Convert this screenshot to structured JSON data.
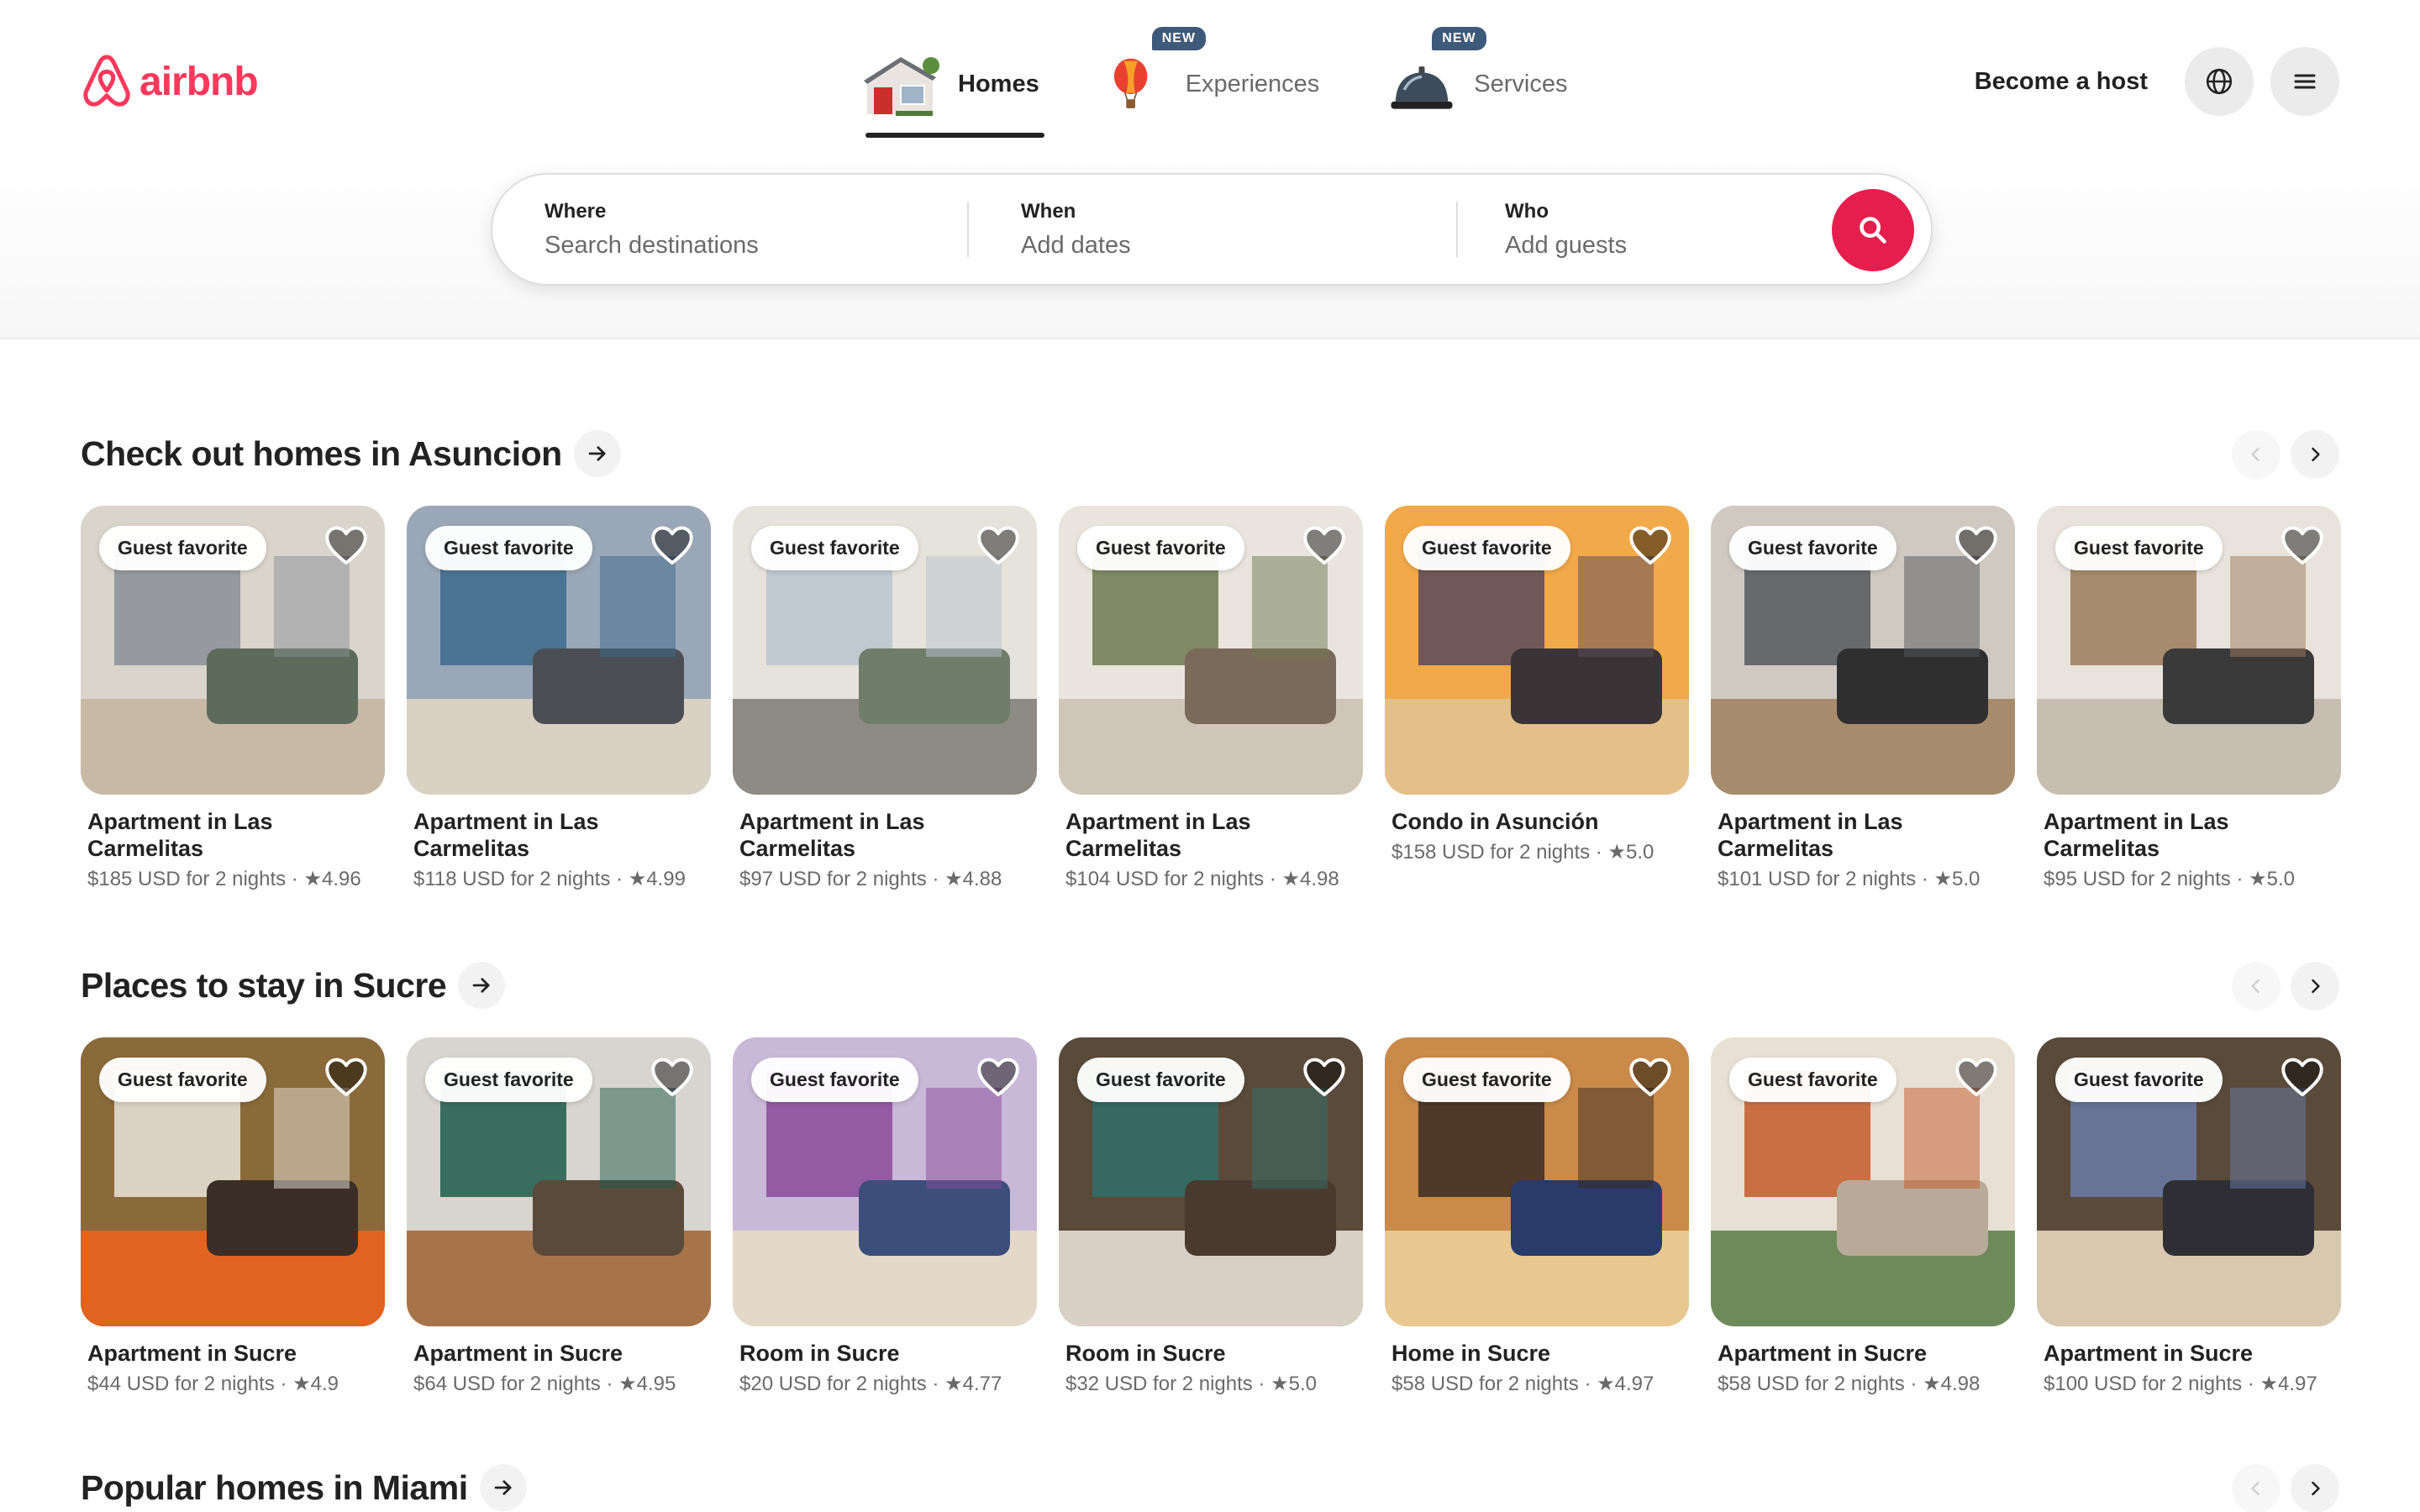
{
  "header": {
    "brand": "airbnb",
    "tabs": [
      {
        "label": "Homes",
        "active": true,
        "badge": ""
      },
      {
        "label": "Experiences",
        "active": false,
        "badge": "NEW"
      },
      {
        "label": "Services",
        "active": false,
        "badge": "NEW"
      }
    ],
    "host_link": "Become a host",
    "icons": {
      "language": "globe-icon",
      "menu": "hamburger-menu-icon"
    }
  },
  "search": {
    "where_label": "Where",
    "where_placeholder": "Search destinations",
    "when_label": "When",
    "when_placeholder": "Add dates",
    "who_label": "Who",
    "who_placeholder": "Add guests"
  },
  "colors": {
    "brand": "#ff385c",
    "search_button": "#e61e4d",
    "badge": "#3e5a7a"
  },
  "card_badge": "Guest favorite",
  "sections": [
    {
      "title": "Check out homes in Asuncion",
      "cards": [
        {
          "title": "Apartment in Las Carmelitas",
          "price": "$185 USD for 2 nights",
          "rating": "4.96"
        },
        {
          "title": "Apartment in Las Carmelitas",
          "price": "$118 USD for 2 nights",
          "rating": "4.99"
        },
        {
          "title": "Apartment in Las Carmelitas",
          "price": "$97 USD for 2 nights",
          "rating": "4.88"
        },
        {
          "title": "Apartment in Las Carmelitas",
          "price": "$104 USD for 2 nights",
          "rating": "4.98"
        },
        {
          "title": "Condo in Asunción",
          "price": "$158 USD for 2 nights",
          "rating": "5.0"
        },
        {
          "title": "Apartment in Las Carmelitas",
          "price": "$101 USD for 2 nights",
          "rating": "5.0"
        },
        {
          "title": "Apartment in Las Carmelitas",
          "price": "$95 USD for 2 nights",
          "rating": "5.0"
        }
      ]
    },
    {
      "title": "Places to stay in Sucre",
      "cards": [
        {
          "title": "Apartment in Sucre",
          "price": "$44 USD for 2 nights",
          "rating": "4.9"
        },
        {
          "title": "Apartment in Sucre",
          "price": "$64 USD for 2 nights",
          "rating": "4.95"
        },
        {
          "title": "Room in Sucre",
          "price": "$20 USD for 2 nights",
          "rating": "4.77"
        },
        {
          "title": "Room in Sucre",
          "price": "$32 USD for 2 nights",
          "rating": "5.0"
        },
        {
          "title": "Home in Sucre",
          "price": "$58 USD for 2 nights",
          "rating": "4.97"
        },
        {
          "title": "Apartment in Sucre",
          "price": "$58 USD for 2 nights",
          "rating": "4.98"
        },
        {
          "title": "Apartment in Sucre",
          "price": "$100 USD for 2 nights",
          "rating": "4.97"
        }
      ]
    },
    {
      "title": "Popular homes in Miami",
      "cards": []
    }
  ]
}
